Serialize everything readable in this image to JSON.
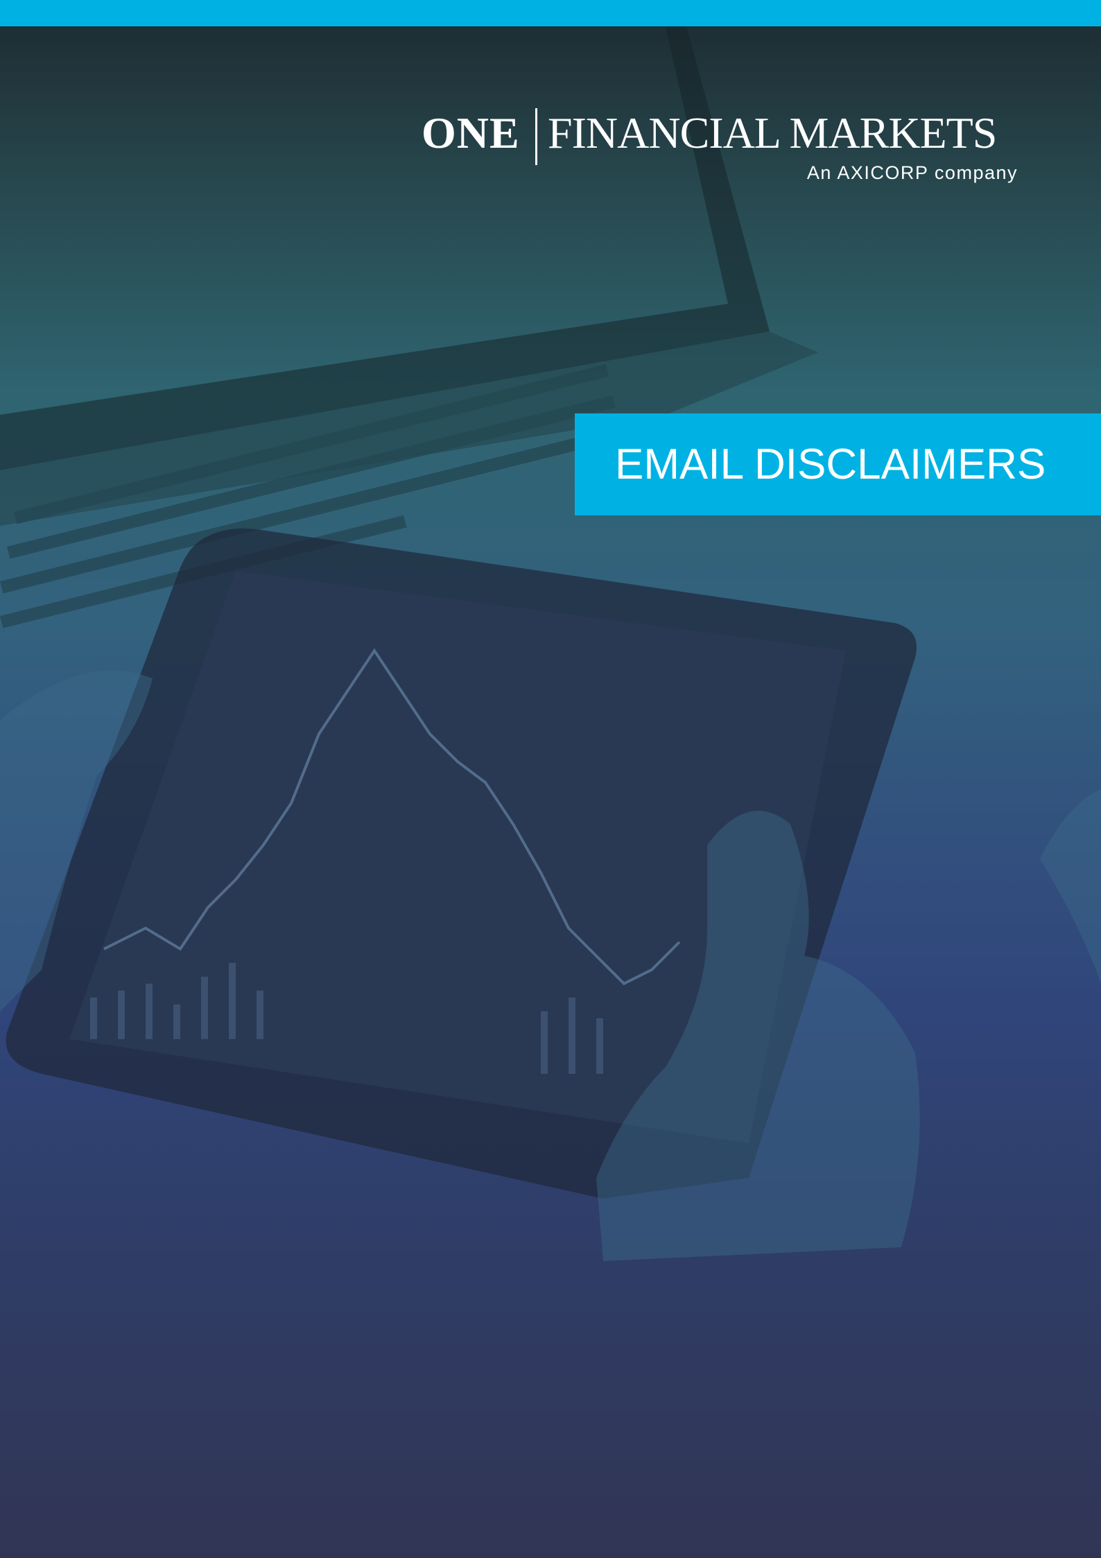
{
  "logo": {
    "primary": "ONE",
    "name": "FINANCIAL MARKETS",
    "tagline": "An AXICORP company"
  },
  "title": "EMAIL DISCLAIMERS",
  "colors": {
    "accent": "#00b2e3",
    "text": "#ffffff"
  }
}
